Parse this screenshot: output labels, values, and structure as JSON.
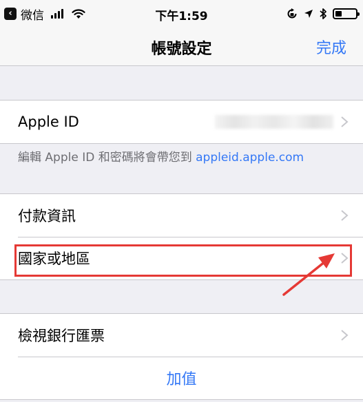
{
  "status_bar": {
    "app": "微信",
    "time": "下午1:59"
  },
  "nav": {
    "title": "帳號設定",
    "done": "完成"
  },
  "apple_id_section": {
    "label": "Apple ID",
    "footnote_prefix": "編輯 Apple ID 和密碼將會帶您到 ",
    "footnote_link": "appleid.apple.com"
  },
  "payment_section": {
    "payment_info": "付款資訊",
    "country_region": "國家或地區"
  },
  "bank_section": {
    "view_bank_drafts": "檢視銀行匯票",
    "top_up": "加值"
  },
  "colors": {
    "accent": "#3478f6",
    "annotation": "#e53935"
  },
  "icons": [
    "back-app-icon",
    "signal-icon",
    "wifi-icon",
    "orientation-lock-icon",
    "location-icon",
    "bluetooth-icon",
    "battery-icon",
    "chevron-right-icon",
    "annotation-arrow-icon"
  ]
}
